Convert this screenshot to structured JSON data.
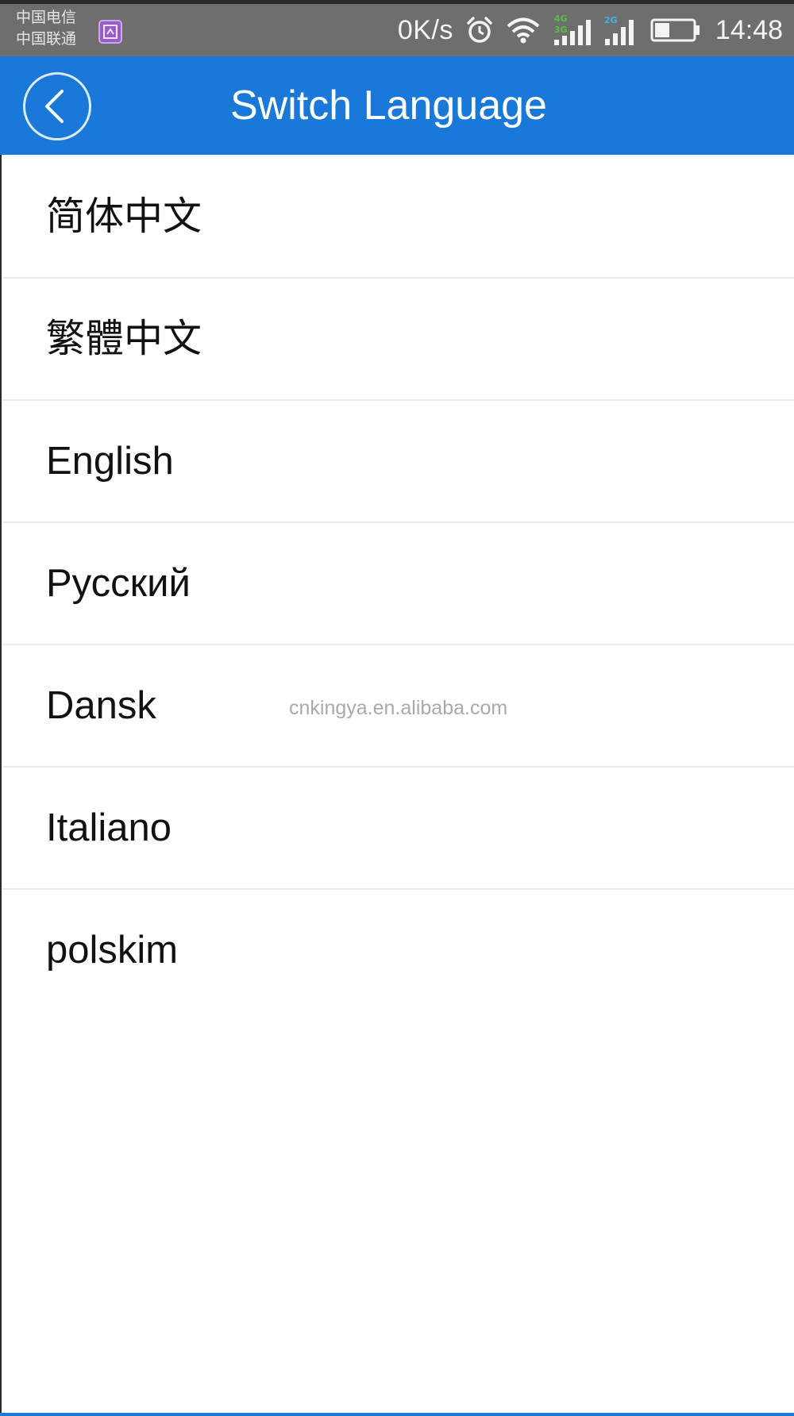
{
  "status_bar": {
    "carriers": [
      "中国电信",
      "中国联通"
    ],
    "notification_icon": "app-notification-icon",
    "net_speed": "0K/s",
    "icons": [
      "alarm-icon",
      "wifi-icon",
      "signal-4g-icon",
      "signal-3g-icon",
      "battery-icon"
    ],
    "signal_tags": {
      "sim1_top": "4G",
      "sim1_bottom": "3G",
      "sim2_top": "2G"
    },
    "battery_level": 0.35,
    "time": "14:48"
  },
  "app_bar": {
    "back_icon": "chevron-left-icon",
    "title": "Switch Language",
    "color": "#1a78d8"
  },
  "languages": [
    {
      "label": "简体中文"
    },
    {
      "label": "繁體中文"
    },
    {
      "label": "English"
    },
    {
      "label": "Русский"
    },
    {
      "label": "Dansk"
    },
    {
      "label": "Italiano"
    },
    {
      "label": "polskim"
    }
  ],
  "watermark": "cnkingya.en.alibaba.com"
}
